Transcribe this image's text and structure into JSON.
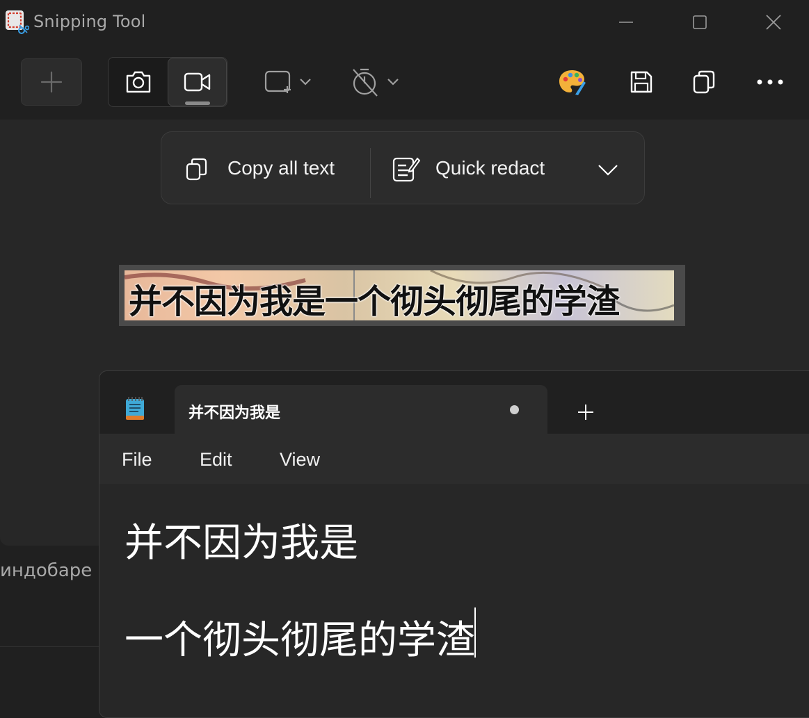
{
  "snipping_tool": {
    "title": "Snipping Tool",
    "toolbar": {
      "new_label": "+",
      "modes": [
        "photo",
        "video"
      ],
      "active_mode": "video"
    },
    "action_bar": {
      "copy_all_text": "Copy all text",
      "quick_redact": "Quick redact"
    },
    "capture_text": "并不因为我是一个彻头彻尾的学渣"
  },
  "background_window": {
    "partial_text": "индобаре"
  },
  "notepad": {
    "tab_title": "并不因为我是",
    "menu": [
      "File",
      "Edit",
      "View"
    ],
    "content_lines": [
      "并不因为我是",
      "一个彻头彻尾的学渣"
    ]
  },
  "colors": {
    "window_bg": "#202020",
    "panel_bg": "#272727",
    "accent_icon_red": "#d13b2b"
  }
}
